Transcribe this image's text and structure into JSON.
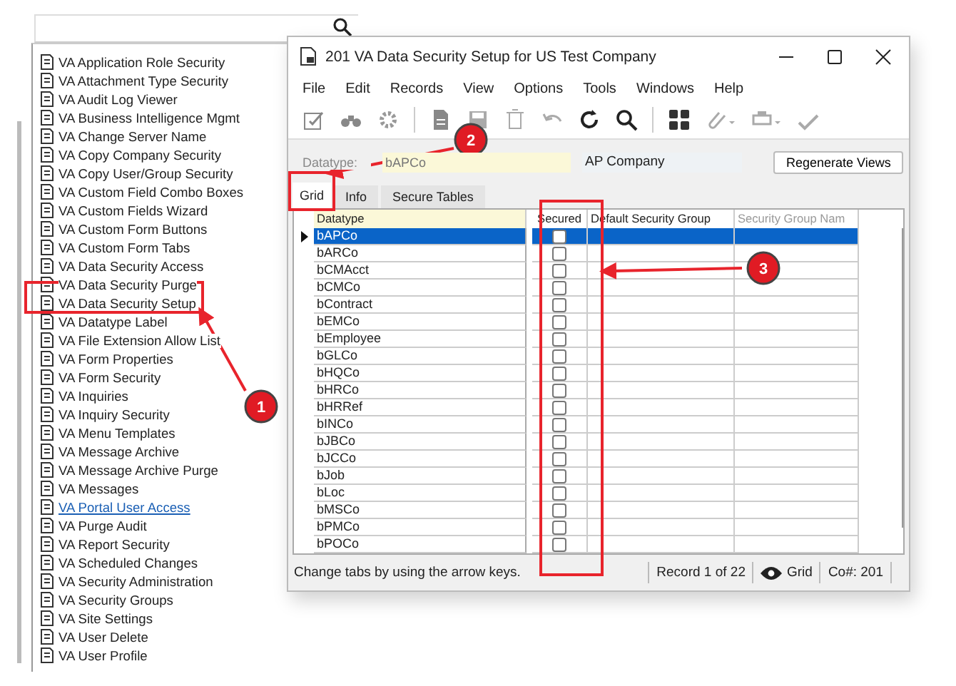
{
  "left_panel": {
    "items": [
      {
        "label": "VA Application Role Security",
        "kind": "form"
      },
      {
        "label": "VA Attachment Type Security",
        "kind": "form"
      },
      {
        "label": "VA Audit Log Viewer",
        "kind": "form"
      },
      {
        "label": "VA Business Intelligence Mgmt",
        "kind": "form"
      },
      {
        "label": "VA Change Server Name",
        "kind": "form"
      },
      {
        "label": "VA Copy Company Security",
        "kind": "form"
      },
      {
        "label": "VA Copy User/Group Security",
        "kind": "form"
      },
      {
        "label": "VA Custom Field Combo Boxes",
        "kind": "form"
      },
      {
        "label": "VA Custom Fields Wizard",
        "kind": "form"
      },
      {
        "label": "VA Custom Form Buttons",
        "kind": "form"
      },
      {
        "label": "VA Custom Form Tabs",
        "kind": "form"
      },
      {
        "label": "VA Data Security Access",
        "kind": "form"
      },
      {
        "label": "VA Data Security Purge",
        "kind": "form"
      },
      {
        "label": "VA Data Security Setup",
        "kind": "form"
      },
      {
        "label": "VA Datatype Label",
        "kind": "form"
      },
      {
        "label": "VA File Extension Allow List",
        "kind": "form"
      },
      {
        "label": "VA Form Properties",
        "kind": "form"
      },
      {
        "label": "VA Form Security",
        "kind": "form"
      },
      {
        "label": "VA Inquiries",
        "kind": "form"
      },
      {
        "label": "VA Inquiry Security",
        "kind": "form"
      },
      {
        "label": "VA Menu Templates",
        "kind": "form"
      },
      {
        "label": "VA Message Archive",
        "kind": "form"
      },
      {
        "label": "VA Message Archive Purge",
        "kind": "form"
      },
      {
        "label": "VA Messages",
        "kind": "form"
      },
      {
        "label": "VA Portal User Access",
        "kind": "link"
      },
      {
        "label": "VA Purge Audit",
        "kind": "form"
      },
      {
        "label": "VA Report Security",
        "kind": "form"
      },
      {
        "label": "VA Scheduled Changes",
        "kind": "form"
      },
      {
        "label": "VA Security Administration",
        "kind": "form"
      },
      {
        "label": "VA Security Groups",
        "kind": "form"
      },
      {
        "label": "VA Site Settings",
        "kind": "form"
      },
      {
        "label": "VA User Delete",
        "kind": "form"
      },
      {
        "label": "VA User Profile",
        "kind": "form"
      }
    ]
  },
  "window": {
    "title": "201 VA Data Security Setup for US Test Company",
    "menu": [
      "File",
      "Edit",
      "Records",
      "View",
      "Options",
      "Tools",
      "Windows",
      "Help"
    ],
    "form": {
      "datatype_label": "Datatype:",
      "datatype_value": "bAPCo",
      "description": "AP Company",
      "regenerate_button": "Regenerate Views"
    },
    "tabs": [
      {
        "label": "Grid",
        "selected": true
      },
      {
        "label": "Info",
        "selected": false
      },
      {
        "label": "Secure Tables",
        "selected": false
      }
    ],
    "grid": {
      "columns": [
        "Datatype",
        "Secured",
        "Default Security Group",
        "Security Group Nam"
      ],
      "rows": [
        {
          "datatype": "bAPCo",
          "secured": false,
          "selected": true
        },
        {
          "datatype": "bARCo",
          "secured": false,
          "selected": false
        },
        {
          "datatype": "bCMAcct",
          "secured": false,
          "selected": false
        },
        {
          "datatype": "bCMCo",
          "secured": false,
          "selected": false
        },
        {
          "datatype": "bContract",
          "secured": false,
          "selected": false
        },
        {
          "datatype": "bEMCo",
          "secured": false,
          "selected": false
        },
        {
          "datatype": "bEmployee",
          "secured": false,
          "selected": false
        },
        {
          "datatype": "bGLCo",
          "secured": false,
          "selected": false
        },
        {
          "datatype": "bHQCo",
          "secured": false,
          "selected": false
        },
        {
          "datatype": "bHRCo",
          "secured": false,
          "selected": false
        },
        {
          "datatype": "bHRRef",
          "secured": false,
          "selected": false
        },
        {
          "datatype": "bINCo",
          "secured": false,
          "selected": false
        },
        {
          "datatype": "bJBCo",
          "secured": false,
          "selected": false
        },
        {
          "datatype": "bJCCo",
          "secured": false,
          "selected": false
        },
        {
          "datatype": "bJob",
          "secured": false,
          "selected": false
        },
        {
          "datatype": "bLoc",
          "secured": false,
          "selected": false
        },
        {
          "datatype": "bMSCo",
          "secured": false,
          "selected": false
        },
        {
          "datatype": "bPMCo",
          "secured": false,
          "selected": false
        },
        {
          "datatype": "bPOCo",
          "secured": false,
          "selected": false
        }
      ]
    },
    "status_bar": {
      "hint": "Change tabs by using the arrow keys.",
      "record": "Record 1 of 22",
      "view": "Grid",
      "company": "Co#: 201"
    }
  },
  "annotations": [
    {
      "number": "1"
    },
    {
      "number": "2"
    },
    {
      "number": "3"
    }
  ]
}
